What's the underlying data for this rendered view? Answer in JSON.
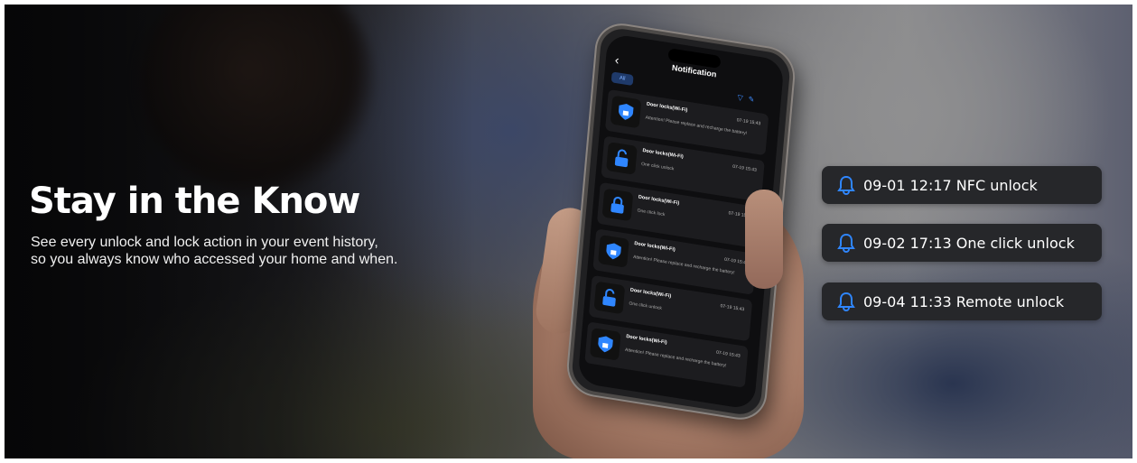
{
  "hero": {
    "headline": "Stay in the Know",
    "subtext_line1": "See every unlock and lock action in your event history,",
    "subtext_line2": "so you always know who accessed your home and when."
  },
  "phone": {
    "screen_title": "Notification",
    "filter_tab": "All",
    "cards": [
      {
        "icon": "shield-lock-icon",
        "title": "Door locks(Wi-Fi)",
        "time": "07-19 15:43",
        "message": "Attention! Please replace and recharge the battery!"
      },
      {
        "icon": "unlocked-padlock-icon",
        "title": "Door locks(Wi-Fi)",
        "time": "07-19 15:43",
        "message": "One click unlock"
      },
      {
        "icon": "locked-padlock-icon",
        "title": "Door locks(Wi-Fi)",
        "time": "07-19 15:43",
        "message": "One click lock"
      },
      {
        "icon": "shield-lock-icon",
        "title": "Door locks(Wi-Fi)",
        "time": "07-19 15:43",
        "message": "Attention! Please replace and recharge the battery!"
      },
      {
        "icon": "unlocked-padlock-icon",
        "title": "Door locks(Wi-Fi)",
        "time": "07-19 15:43",
        "message": "One click unlock"
      },
      {
        "icon": "shield-lock-icon",
        "title": "Door locks(Wi-Fi)",
        "time": "07-19 15:43",
        "message": "Attention! Please replace and recharge the battery!"
      }
    ]
  },
  "notifications": [
    {
      "icon": "bell-icon",
      "text": "09-01 12:17 NFC unlock"
    },
    {
      "icon": "bell-icon",
      "text": "09-02 17:13 One click unlock"
    },
    {
      "icon": "bell-icon",
      "text": "09-04 11:33 Remote unlock"
    }
  ],
  "colors": {
    "accent": "#2f86ff",
    "card_bg": "#26272a"
  }
}
